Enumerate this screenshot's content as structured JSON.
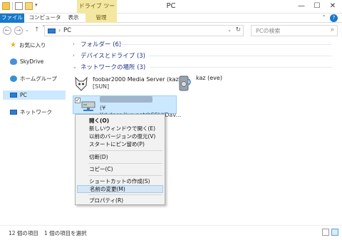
{
  "window": {
    "title": "PC",
    "context_tab_title": "ドライブ ツール",
    "min": "—",
    "max": "☐",
    "close": "✕"
  },
  "ribbon": {
    "tabs": [
      "ファイル",
      "コンピューター",
      "表示",
      "管理"
    ],
    "help": "?",
    "collapse": "⌃"
  },
  "address": {
    "path": "PC",
    "sep": "›",
    "dropdown": "⌄",
    "refresh": "↻",
    "back": "←",
    "forward": "→",
    "nav_dropdown": "⌄",
    "up": "↑"
  },
  "search": {
    "placeholder": "PCの検索",
    "icon": "⌕"
  },
  "sidebar": {
    "items": [
      {
        "label": "お気に入り",
        "icon": "star-icon"
      },
      {
        "label": "SkyDrive",
        "icon": "skydrive-icon"
      },
      {
        "label": "ホームグループ",
        "icon": "homegroup-icon"
      },
      {
        "label": "PC",
        "icon": "pc-icon"
      },
      {
        "label": "ネットワーク",
        "icon": "network-icon"
      }
    ]
  },
  "groups": [
    {
      "label": "フォルダー (6)",
      "expand": "›"
    },
    {
      "label": "デバイスとドライブ (3)",
      "expand": "›"
    },
    {
      "label": "ネットワークの場所 (3)",
      "expand": "⌄"
    }
  ],
  "network_items": [
    {
      "name": "foobar2000 Media Server (kaz)",
      "sub": "[SUN]"
    },
    {
      "name": "kaz (eve)",
      "sub": ""
    },
    {
      "name": "",
      "sub": "(¥¥d.docs.live.net@SSL¥Dav..."
    }
  ],
  "context_menu": {
    "items": [
      "開く(O)",
      "新しいウィンドウで開く(E)",
      "以前のバージョンの復元(V)",
      "スタートにピン留め(P)",
      "切断(D)",
      "コピー(C)",
      "ショートカットの作成(S)",
      "名前の変更(M)",
      "プロパティ(R)"
    ]
  },
  "status": {
    "count": "12 個の項目",
    "selected": "1 個の項目を選択"
  },
  "colors": {
    "accent": "#1979ca",
    "group_header": "#1e3287",
    "selection": "#cce8ff",
    "context_tab": "#f4e7a1"
  }
}
